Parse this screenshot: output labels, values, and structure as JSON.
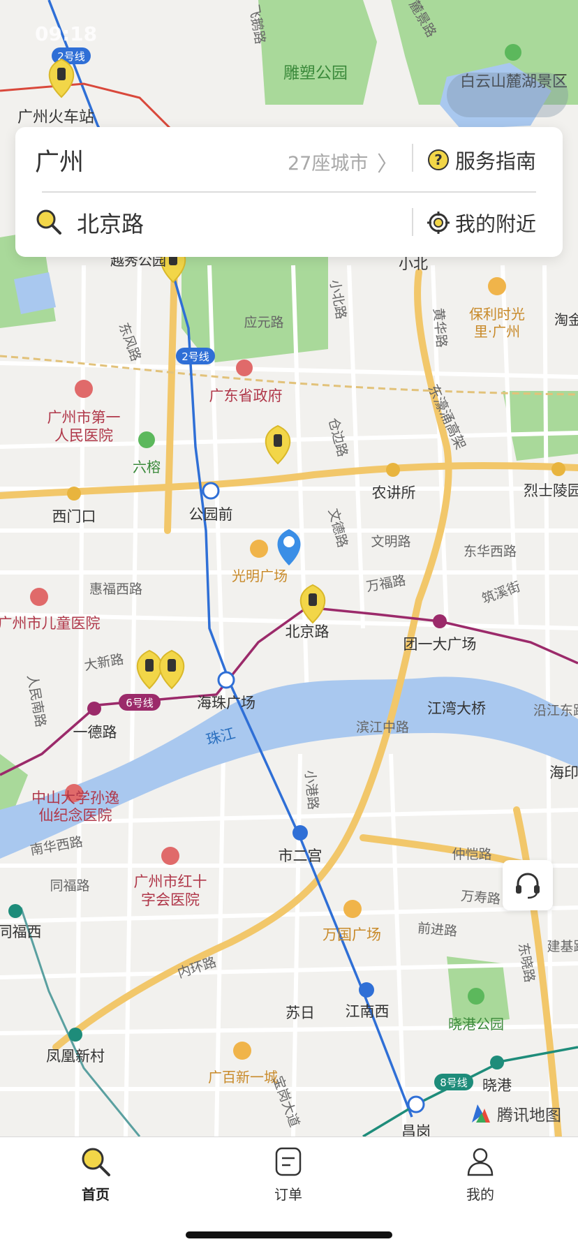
{
  "status_bar": {
    "time": "09:18"
  },
  "search": {
    "city": "广州",
    "city_count": "27座城市",
    "guide_label": "服务指南",
    "keyword": "北京路",
    "nearby_label": "我的附近"
  },
  "map": {
    "attribution": "腾讯地图",
    "labels": [
      {
        "text": "雕塑公园",
        "kind": "green"
      },
      {
        "text": "白云山麓湖景区",
        "kind": "dark"
      },
      {
        "text": "广州火车站",
        "kind": "dark"
      },
      {
        "text": "越秀公园",
        "kind": "dark"
      },
      {
        "text": "小北",
        "kind": "dark"
      },
      {
        "text": "保利时光",
        "kind": "orange"
      },
      {
        "text": "里·广州",
        "kind": "orange"
      },
      {
        "text": "淘金",
        "kind": "dark"
      },
      {
        "text": "应元路",
        "kind": "road"
      },
      {
        "text": "东风路",
        "kind": "road"
      },
      {
        "text": "小北路",
        "kind": "road"
      },
      {
        "text": "黄华路",
        "kind": "road"
      },
      {
        "text": "东濠涌高架",
        "kind": "road"
      },
      {
        "text": "广东省政府",
        "kind": "red"
      },
      {
        "text": "广州市第一",
        "kind": "red"
      },
      {
        "text": "人民医院",
        "kind": "red"
      },
      {
        "text": "六榕",
        "kind": "green"
      },
      {
        "text": "仓边路",
        "kind": "road"
      },
      {
        "text": "西门口",
        "kind": "dark"
      },
      {
        "text": "公园前",
        "kind": "dark"
      },
      {
        "text": "农讲所",
        "kind": "dark"
      },
      {
        "text": "烈士陵园",
        "kind": "dark"
      },
      {
        "text": "文德路",
        "kind": "road"
      },
      {
        "text": "文明路",
        "kind": "road"
      },
      {
        "text": "东华西路",
        "kind": "road"
      },
      {
        "text": "光明广场",
        "kind": "orange"
      },
      {
        "text": "惠福西路",
        "kind": "road"
      },
      {
        "text": "万福路",
        "kind": "road"
      },
      {
        "text": "筑溪街",
        "kind": "road"
      },
      {
        "text": "广州市儿童医院",
        "kind": "red"
      },
      {
        "text": "北京路",
        "kind": "dark"
      },
      {
        "text": "团一大广场",
        "kind": "dark"
      },
      {
        "text": "大新路",
        "kind": "road"
      },
      {
        "text": "海珠广场",
        "kind": "dark"
      },
      {
        "text": "江湾大桥",
        "kind": "dark"
      },
      {
        "text": "沿江东路",
        "kind": "road"
      },
      {
        "text": "人民南路",
        "kind": "road"
      },
      {
        "text": "一德路",
        "kind": "dark"
      },
      {
        "text": "珠江",
        "kind": "water"
      },
      {
        "text": "滨江中路",
        "kind": "road"
      },
      {
        "text": "海印",
        "kind": "dark"
      },
      {
        "text": "小港路",
        "kind": "road"
      },
      {
        "text": "中山大学孙逸",
        "kind": "red"
      },
      {
        "text": "仙纪念医院",
        "kind": "red"
      },
      {
        "text": "南华西路",
        "kind": "road"
      },
      {
        "text": "市二宫",
        "kind": "dark"
      },
      {
        "text": "仲恺路",
        "kind": "road"
      },
      {
        "text": "同福路",
        "kind": "road"
      },
      {
        "text": "广州市红十",
        "kind": "red"
      },
      {
        "text": "字会医院",
        "kind": "red"
      },
      {
        "text": "万寿路",
        "kind": "road"
      },
      {
        "text": "同福西",
        "kind": "dark"
      },
      {
        "text": "万国广场",
        "kind": "orange"
      },
      {
        "text": "前进路",
        "kind": "road"
      },
      {
        "text": "东晓路",
        "kind": "road"
      },
      {
        "text": "建基路",
        "kind": "road"
      },
      {
        "text": "内环路",
        "kind": "road"
      },
      {
        "text": "苏日",
        "kind": "dark"
      },
      {
        "text": "江南西",
        "kind": "dark"
      },
      {
        "text": "晓港公园",
        "kind": "green"
      },
      {
        "text": "凤凰新村",
        "kind": "dark"
      },
      {
        "text": "广百新一城",
        "kind": "orange"
      },
      {
        "text": "晓港",
        "kind": "dark"
      },
      {
        "text": "昌岗",
        "kind": "dark"
      },
      {
        "text": "宝岗大道",
        "kind": "road"
      },
      {
        "text": "飞鹅路",
        "kind": "road"
      },
      {
        "text": "麓景路",
        "kind": "road"
      }
    ],
    "line_badges": [
      {
        "text": "2号线",
        "color": "#2f6fd6"
      },
      {
        "text": "2号线",
        "color": "#2f6fd6"
      },
      {
        "text": "6号线",
        "color": "#9b2a6a"
      },
      {
        "text": "8号线",
        "color": "#1e8c7a"
      }
    ],
    "colors": {
      "metro2": "#2f6fd6",
      "metro6": "#9b2a6a",
      "metro8": "#1e8c7a",
      "highway": "#f2c76a",
      "river": "#a9c8ef",
      "park": "#a9d99a",
      "pin": "#f2d648",
      "my_location": "#3a8ee6"
    }
  },
  "tabs": [
    {
      "label": "首页",
      "icon": "search-icon",
      "active": true
    },
    {
      "label": "订单",
      "icon": "order-icon",
      "active": false
    },
    {
      "label": "我的",
      "icon": "user-icon",
      "active": false
    }
  ]
}
